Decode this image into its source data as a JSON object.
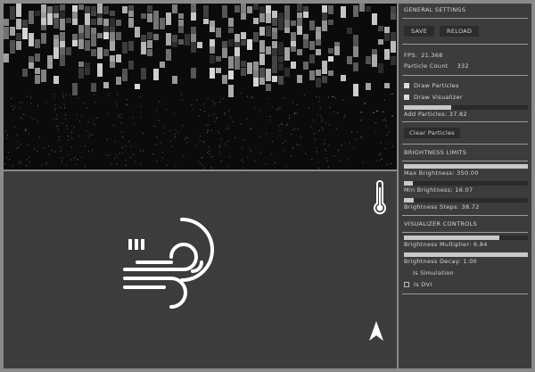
{
  "panel": {
    "general": {
      "title": "GENERAL SETTINGS",
      "save_label": "SAVE",
      "reload_label": "RELOAD",
      "fps_label": "FPS:",
      "fps_value": "21.368",
      "particle_label": "Particle Count",
      "particle_value": "332",
      "draw_particles": {
        "label": "Draw Particles",
        "checked": true
      },
      "draw_visualizer": {
        "label": "Draw Visualizer",
        "checked": true
      },
      "add_particles": {
        "label": "Add Particles: 37.82",
        "value": 0.38
      },
      "clear_label": "Clear Particles"
    },
    "brightness": {
      "title": "BRIGHTNESS LIMITS",
      "max": {
        "label": "Max Brightness: 350.00",
        "value": 1.0
      },
      "min": {
        "label": "Min Brightness: 16.07",
        "value": 0.07
      },
      "steps": {
        "label": "Brightness Steps: 38.72",
        "value": 0.08
      }
    },
    "visualizer": {
      "title": "VISUALIZER CONTROLS",
      "multiplier": {
        "label": "Brightness Multiplier: 6.84",
        "value": 0.77
      },
      "decay": {
        "label": "Brightness Decay: 1.00",
        "value": 1.0
      },
      "is_simulation": {
        "label": "Is Simulation",
        "checked": false
      },
      "is_dvi": {
        "label": "Is DVI",
        "checked": false
      }
    }
  },
  "scene": {
    "icons": [
      "wind-icon",
      "thermometer-icon",
      "north-arrow-icon"
    ]
  },
  "colors": {
    "panel_bg": "#3c3c3c",
    "viz_bg": "#0b0b0b",
    "accent": "#d6d6d6"
  }
}
